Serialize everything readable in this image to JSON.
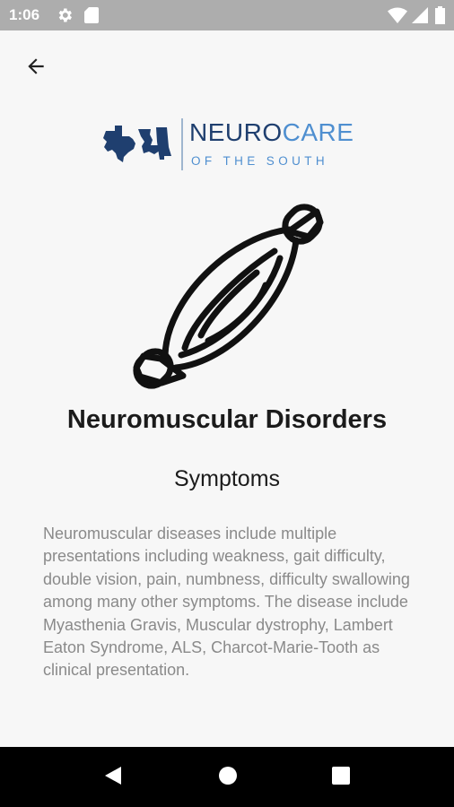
{
  "status_bar": {
    "time": "1:06",
    "icons": [
      "gear-icon",
      "sd-card-icon",
      "wifi-icon",
      "cell-signal-icon",
      "battery-icon"
    ]
  },
  "header": {
    "back_icon": "arrow-left-icon"
  },
  "logo": {
    "word_part1": "NEURO",
    "word_part2": "CARE",
    "tagline": "OF THE SOUTH",
    "colors": {
      "dark": "#1f3f6f",
      "light": "#4f8fd0"
    }
  },
  "main": {
    "icon": "muscle-icon",
    "title": "Neuromuscular Disorders",
    "section_title": "Symptoms",
    "body": "Neuromuscular diseases include multiple presentations including weakness, gait difficulty, double vision, pain, numbness, difficulty swallowing among many other symptoms.  The disease include Myasthenia Gravis, Muscular dystrophy, Lambert Eaton Syndrome, ALS, Charcot-Marie-Tooth as clinical presentation."
  },
  "nav_bar": {
    "buttons": [
      "back-triangle-icon",
      "home-circle-icon",
      "recents-square-icon"
    ]
  }
}
